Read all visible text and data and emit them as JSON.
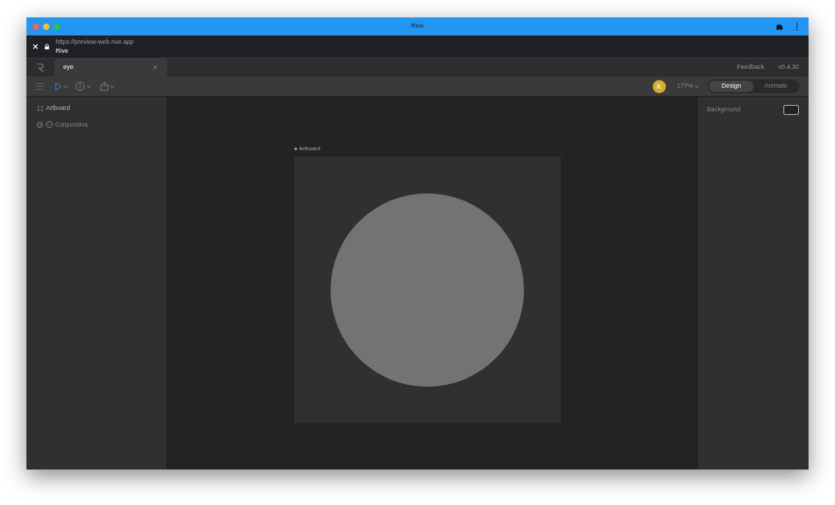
{
  "window": {
    "title": "Rive"
  },
  "address_bar": {
    "url": "https://preview-web.rive.app",
    "page_title": "Rive"
  },
  "tabs": [
    {
      "label": "eye",
      "selected": true
    }
  ],
  "header_links": [
    "Feedback",
    "v0.4.30"
  ],
  "toolbar": {
    "avatar": "K",
    "zoom": "177%",
    "modes": [
      {
        "label": "Design",
        "selected": true
      },
      {
        "label": "Animate",
        "selected": false
      }
    ]
  },
  "hierarchy": [
    {
      "kind": "artboard",
      "label": "Artboard"
    },
    {
      "kind": "shape",
      "label": "Conjunctiva",
      "expanded": false
    }
  ],
  "canvas": {
    "artboard_label": "Artboard"
  },
  "inspector": {
    "background_label": "Background"
  }
}
